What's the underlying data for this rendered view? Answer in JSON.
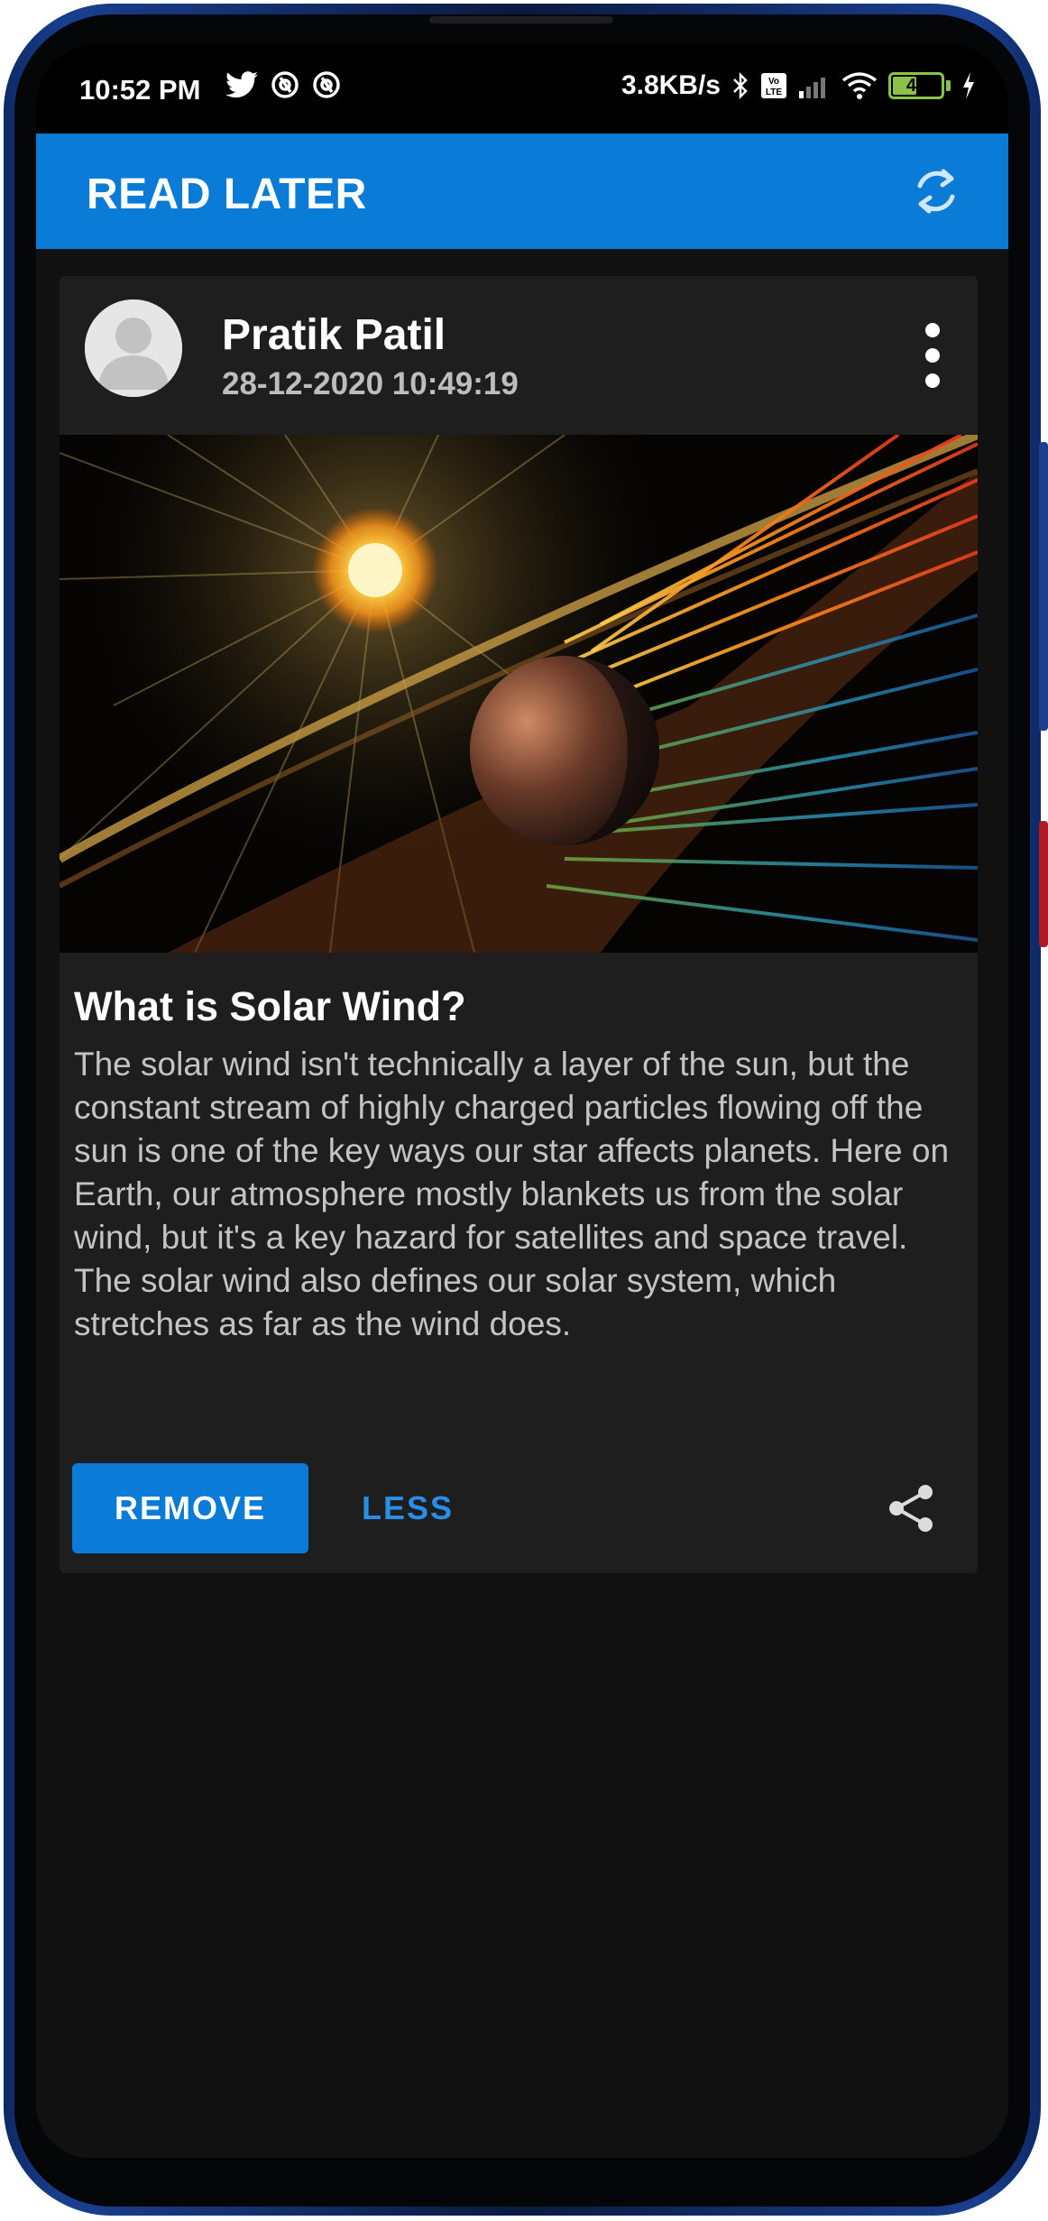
{
  "status_bar": {
    "time": "10:52 PM",
    "net_speed": "3.8KB/s",
    "battery_level": "47"
  },
  "app_bar": {
    "title": "READ LATER"
  },
  "post": {
    "author": "Pratik Patil",
    "timestamp": "28-12-2020 10:49:19",
    "title": "What is Solar Wind?",
    "body": "The solar wind isn't technically a layer of the sun, but the constant stream of highly charged particles flowing off the sun is one of the key ways our star affects planets. Here on Earth, our atmosphere mostly blankets us from the solar wind, but it's a key hazard for satellites and space travel. The solar wind also defines our solar system, which stretches as far as the wind does.",
    "remove_label": "REMOVE",
    "less_label": "LESS"
  },
  "colors": {
    "accent": "#0a7bd6",
    "link": "#2a8ee6",
    "card": "#1e1e1f",
    "background": "#111112"
  },
  "icons": {
    "refresh": "refresh-icon",
    "more": "more-vert-icon",
    "share": "share-icon",
    "avatar": "person-icon"
  }
}
